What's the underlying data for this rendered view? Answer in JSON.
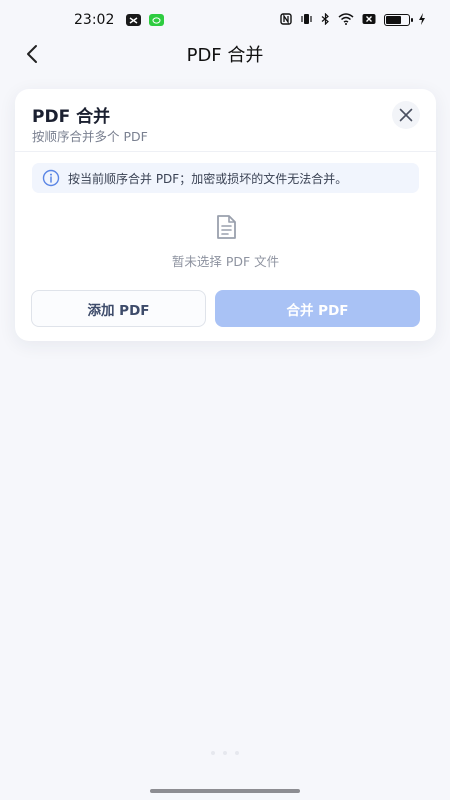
{
  "status_bar": {
    "time": "23:02",
    "apps": [
      "capcut-icon",
      "wechat-icon"
    ],
    "icons": [
      "nfc-icon",
      "vibrate-icon",
      "bluetooth-icon",
      "wifi-icon",
      "sim-off-icon",
      "battery-icon",
      "charging-icon"
    ],
    "battery_level": 0.7
  },
  "nav": {
    "title": "PDF 合并",
    "back_icon": "chevron-left-icon"
  },
  "card": {
    "title": "PDF 合并",
    "subtitle": "按顺序合并多个 PDF",
    "close_icon": "close-icon",
    "info": {
      "icon": "info-icon",
      "text": "按当前顺序合并 PDF；加密或损坏的文件无法合并。"
    },
    "empty": {
      "icon": "document-icon",
      "text": "暂未选择 PDF 文件"
    },
    "buttons": {
      "add_label": "添加 PDF",
      "merge_label": "合并 PDF",
      "merge_enabled": false
    }
  },
  "colors": {
    "background": "#f6f7fb",
    "card": "#ffffff",
    "info_bg": "#f1f5fd",
    "accent_disabled": "#a9c2f5",
    "info_icon": "#5b86e5"
  }
}
